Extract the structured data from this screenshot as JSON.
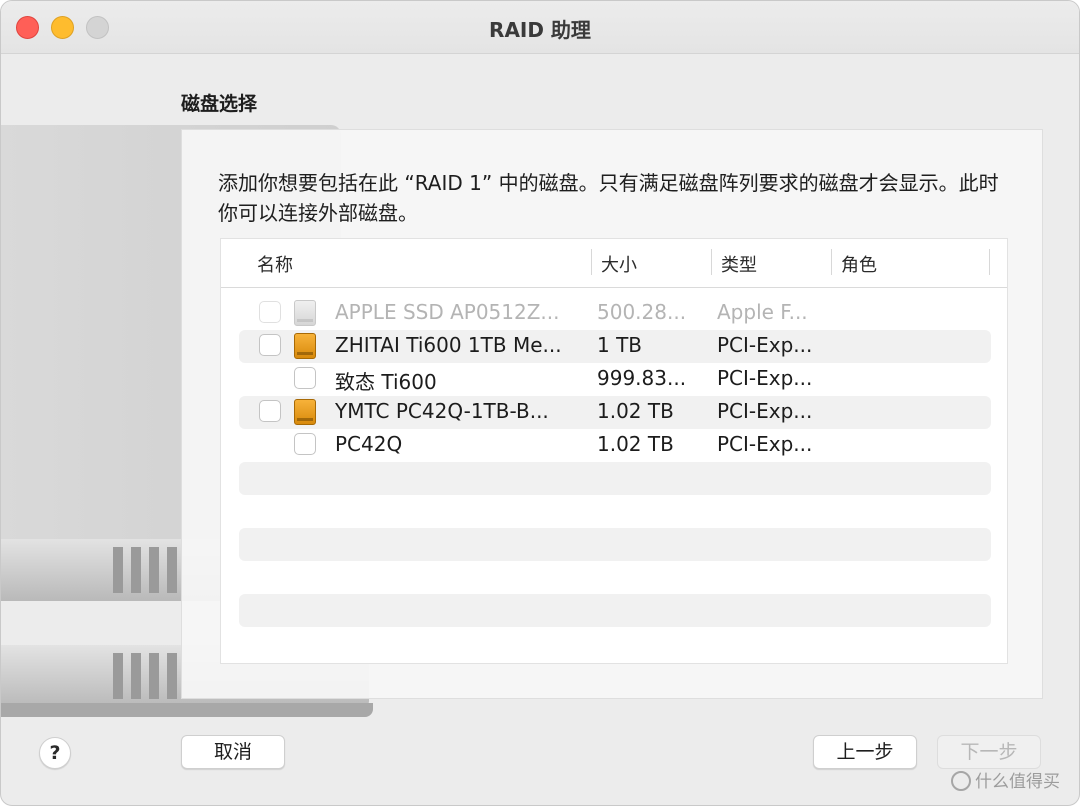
{
  "window": {
    "title": "RAID 助理"
  },
  "section_title": "磁盘选择",
  "description": "添加你想要包括在此 “RAID 1” 中的磁盘。只有满足磁盘阵列要求的磁盘才会显示。此时你可以连接外部磁盘。",
  "table": {
    "columns": [
      "名称",
      "大小",
      "类型",
      "角色"
    ],
    "rows": [
      {
        "name": "APPLE SSD AP0512Z...",
        "size": "500.28...",
        "type": "Apple F...",
        "role": "",
        "disabled": true,
        "indent": false,
        "icon": "internal-disk-icon"
      },
      {
        "name": "ZHITAI Ti600 1TB Me...",
        "size": "1 TB",
        "type": "PCI-Exp...",
        "role": "",
        "disabled": false,
        "indent": false,
        "icon": "external-disk-icon"
      },
      {
        "name": "致态 Ti600",
        "size": "999.83...",
        "type": "PCI-Exp...",
        "role": "",
        "disabled": false,
        "indent": true,
        "icon": ""
      },
      {
        "name": "YMTC PC42Q-1TB-B...",
        "size": "1.02 TB",
        "type": "PCI-Exp...",
        "role": "",
        "disabled": false,
        "indent": false,
        "icon": "external-disk-icon"
      },
      {
        "name": "PC42Q",
        "size": "1.02 TB",
        "type": "PCI-Exp...",
        "role": "",
        "disabled": false,
        "indent": true,
        "icon": ""
      }
    ]
  },
  "buttons": {
    "help": "?",
    "cancel": "取消",
    "back": "上一步",
    "next": "下一步"
  },
  "watermark": "什么值得买"
}
